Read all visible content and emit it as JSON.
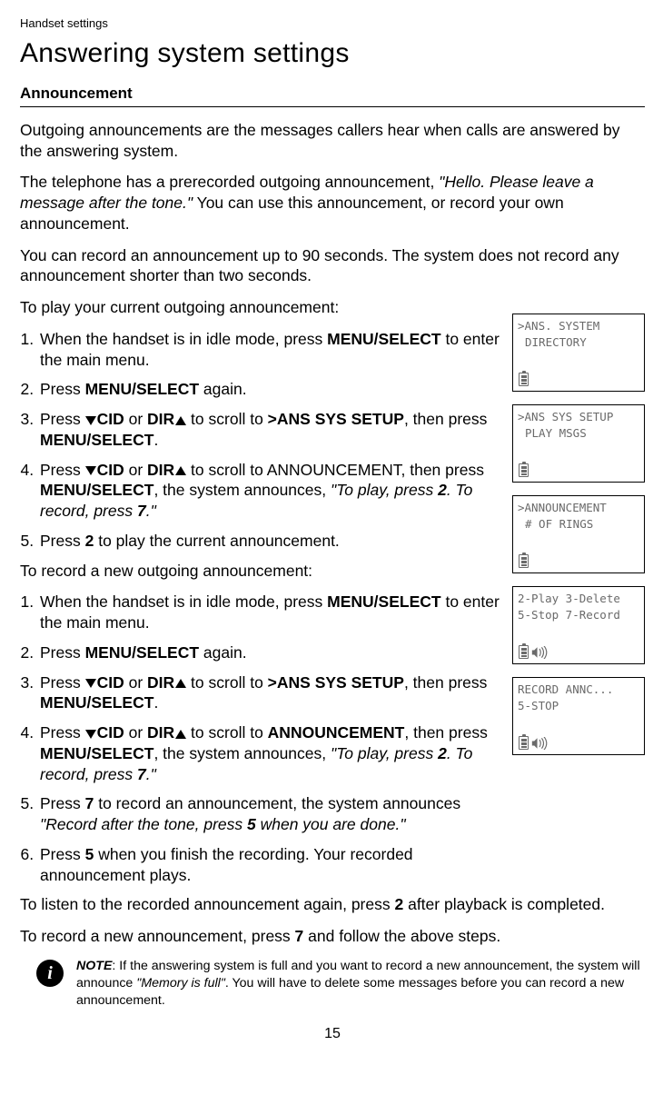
{
  "header": "Handset settings",
  "title": "Answering system settings",
  "subheading": "Announcement",
  "intro1": "Outgoing announcements are the messages callers hear when calls are answered by the answering system.",
  "intro2a": "The telephone has a prerecorded outgoing announcement, ",
  "intro2_quote": "\"Hello. Please leave a message after the tone.\"",
  "intro2b": " You can use this announcement, or record your own announcement.",
  "intro3": "You can record an announcement up to 90 seconds. The system does not record any announcement shorter than two seconds.",
  "playHeading": "To play your current outgoing announcement:",
  "recordHeading": "To record a new outgoing announcement:",
  "step_idle_a": "When the handset is in idle mode, press ",
  "menu_big": "MENU/",
  "select_sc": "SELECT",
  "step_idle_b": " to enter the main menu.",
  "step_press_menu": "Press ",
  "menu_sc": "MENU",
  "slash_select": "/SELECT",
  "again": " again.",
  "cid_label": "CID",
  "or": " or ",
  "dir_label": "DIR",
  "scroll_to": " to scroll to ",
  "ans_sys_setup": ">ANS SYS SETUP",
  "then_press": ", then press ",
  "period": ".",
  "announcement_plain": "ANNOUNCEMENT",
  "announces": ", the system announces, ",
  "toplay_quote_a": "\"To play, press ",
  "two": "2",
  "seven": "7",
  "five": "5",
  "torecord_mid": ". To record, press ",
  "quote_end": ".\"",
  "press2_a": "Press ",
  "press2_b": " to play the current announcement.",
  "press7_a": "Press ",
  "press7_b": " to record an announcement, the system announces ",
  "record_quote_a": "\"Record after the tone, press ",
  "record_quote_b": " when you are done.\"",
  "press5_a": "Press ",
  "press5_b": " when you finish the recording. Your recorded announcement plays.",
  "listen_again_a": "To listen to the recorded announcement again, press ",
  "listen_again_b": " after playback is completed.",
  "new_announce_a": "To record a new announcement, press ",
  "new_announce_b": " and follow the above steps.",
  "note_label": "NOTE",
  "note_a": ": If the answering system is full and you want to record a new announcement, the system will announce ",
  "note_quote": "\"Memory is full\"",
  "note_b": ". You will have to delete some messages before you can record a new announcement.",
  "page_num": "15",
  "screens": [
    {
      "line1": ">ANS. SYSTEM",
      "line2": "DIRECTORY",
      "speaker": false,
      "line2_indent": true
    },
    {
      "line1": ">ANS SYS SETUP",
      "line2": "PLAY MSGS",
      "speaker": false,
      "line2_indent": true
    },
    {
      "line1": ">ANNOUNCEMENT",
      "line2": "# OF RINGS",
      "speaker": false,
      "line2_indent": true
    },
    {
      "line1": "2-Play 3-Delete",
      "line2": "5-Stop 7-Record",
      "speaker": true,
      "line2_indent": false
    },
    {
      "line1": "RECORD ANNC...",
      "line2": "5-STOP",
      "speaker": true,
      "line2_indent": false
    }
  ]
}
